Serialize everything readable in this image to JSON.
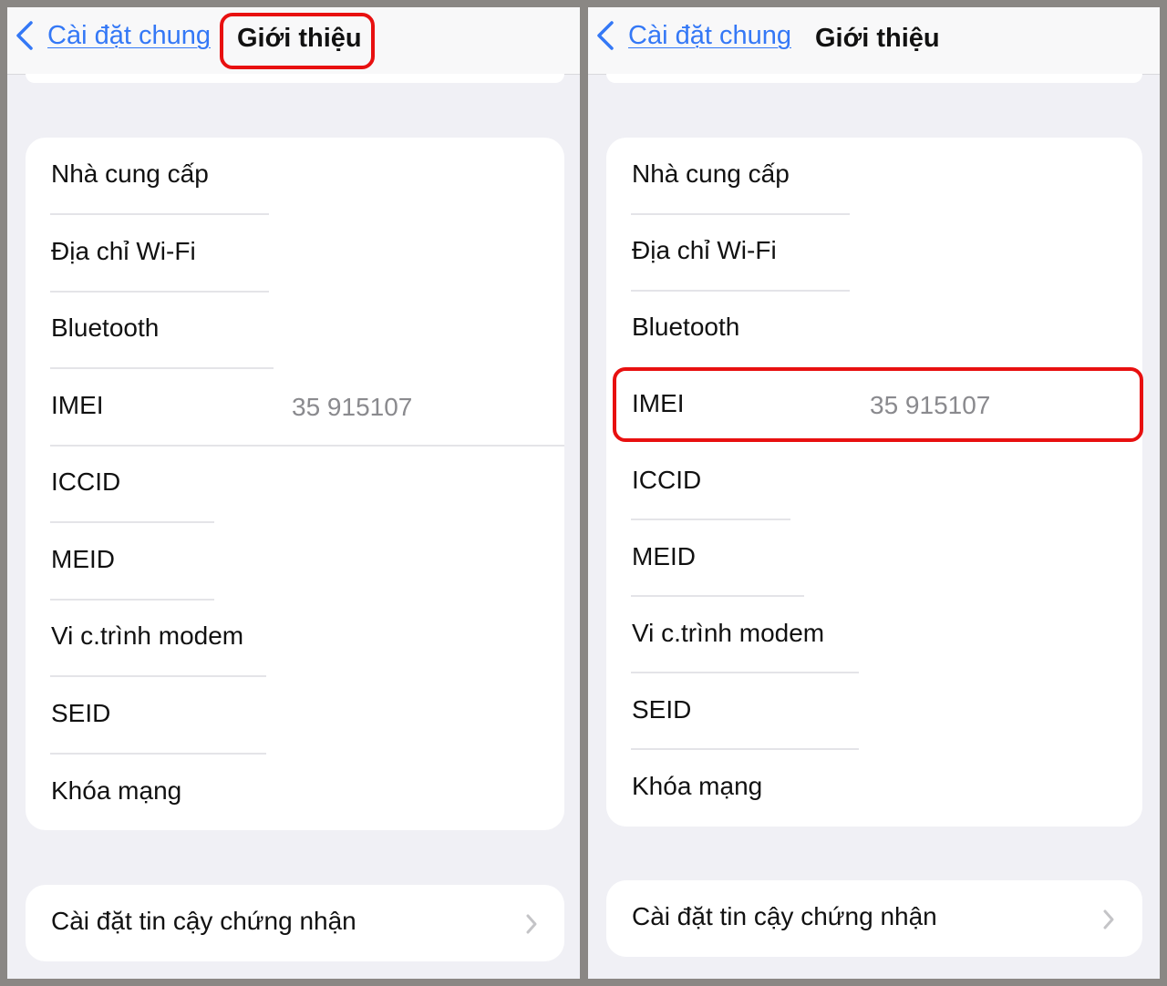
{
  "panels": [
    {
      "id": "left",
      "nav": {
        "back_label": "Cài đặt chung",
        "title": "Giới thiệu"
      },
      "highlight": "title",
      "info_rows": [
        {
          "label": "Nhà cung cấp",
          "value": ""
        },
        {
          "label": "Địa chỉ Wi-Fi",
          "value": ""
        },
        {
          "label": "Bluetooth",
          "value": ""
        },
        {
          "label": "IMEI",
          "value": "35 915107"
        },
        {
          "label": "ICCID",
          "value": ""
        },
        {
          "label": "MEID",
          "value": ""
        },
        {
          "label": "Vi c.trình modem",
          "value": ""
        },
        {
          "label": "SEID",
          "value": ""
        },
        {
          "label": "Khóa mạng",
          "value": ""
        }
      ],
      "cert_row": {
        "label": "Cài đặt tin cậy chứng nhận",
        "icon": "chevron-right-icon"
      }
    },
    {
      "id": "right",
      "nav": {
        "back_label": "Cài đặt chung",
        "title": "Giới thiệu"
      },
      "highlight": "imei-row",
      "info_rows": [
        {
          "label": "Nhà cung cấp",
          "value": ""
        },
        {
          "label": "Địa chỉ Wi-Fi",
          "value": ""
        },
        {
          "label": "Bluetooth",
          "value": ""
        },
        {
          "label": "IMEI",
          "value": "35 915107"
        },
        {
          "label": "ICCID",
          "value": ""
        },
        {
          "label": "MEID",
          "value": ""
        },
        {
          "label": "Vi c.trình modem",
          "value": ""
        },
        {
          "label": "SEID",
          "value": ""
        },
        {
          "label": "Khóa mạng",
          "value": ""
        }
      ],
      "cert_row": {
        "label": "Cài đặt tin cậy chứng nhận",
        "icon": "chevron-right-icon"
      }
    }
  ],
  "colors": {
    "accent": "#3478f6",
    "highlight": "#e81010",
    "background": "#f0f0f5",
    "value_text": "#8a8a8e"
  }
}
